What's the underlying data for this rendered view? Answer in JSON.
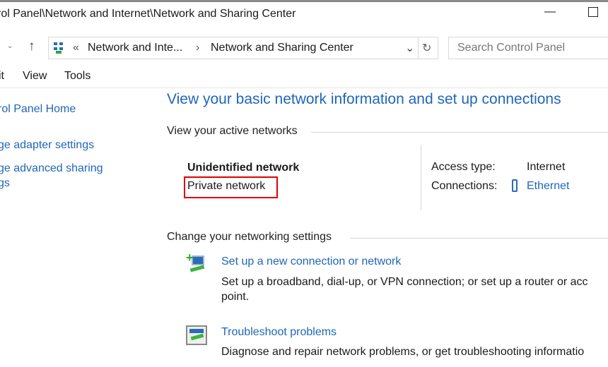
{
  "window": {
    "title": "rol Panel\\Network and Internet\\Network and Sharing Center"
  },
  "address": {
    "segments": [
      "Network and Inte...",
      "Network and Sharing Center"
    ],
    "overflow": "«",
    "separator": "›"
  },
  "search": {
    "placeholder": "Search Control Panel"
  },
  "menu": [
    "it",
    "View",
    "Tools"
  ],
  "sidebar": {
    "items": [
      "rol Panel Home",
      "ge adapter settings",
      "ge advanced sharing",
      "gs"
    ]
  },
  "main": {
    "heading": "View your basic network information and set up connections",
    "active_title": "View your active networks",
    "network": {
      "name": "Unidentified network",
      "type": "Private network",
      "access_label": "Access type:",
      "access_value": "Internet",
      "connections_label": "Connections:",
      "connections_value": "Ethernet"
    },
    "change_title": "Change your networking settings",
    "tasks": [
      {
        "link": "Set up a new connection or network",
        "desc1": "Set up a broadband, dial-up, or VPN connection; or set up a router or acc",
        "desc2": "point."
      },
      {
        "link": "Troubleshoot problems",
        "desc1": "Diagnose and repair network problems, or get troubleshooting informatio"
      }
    ]
  },
  "colors": {
    "link": "#1f66b8",
    "highlight": "#e00000"
  }
}
